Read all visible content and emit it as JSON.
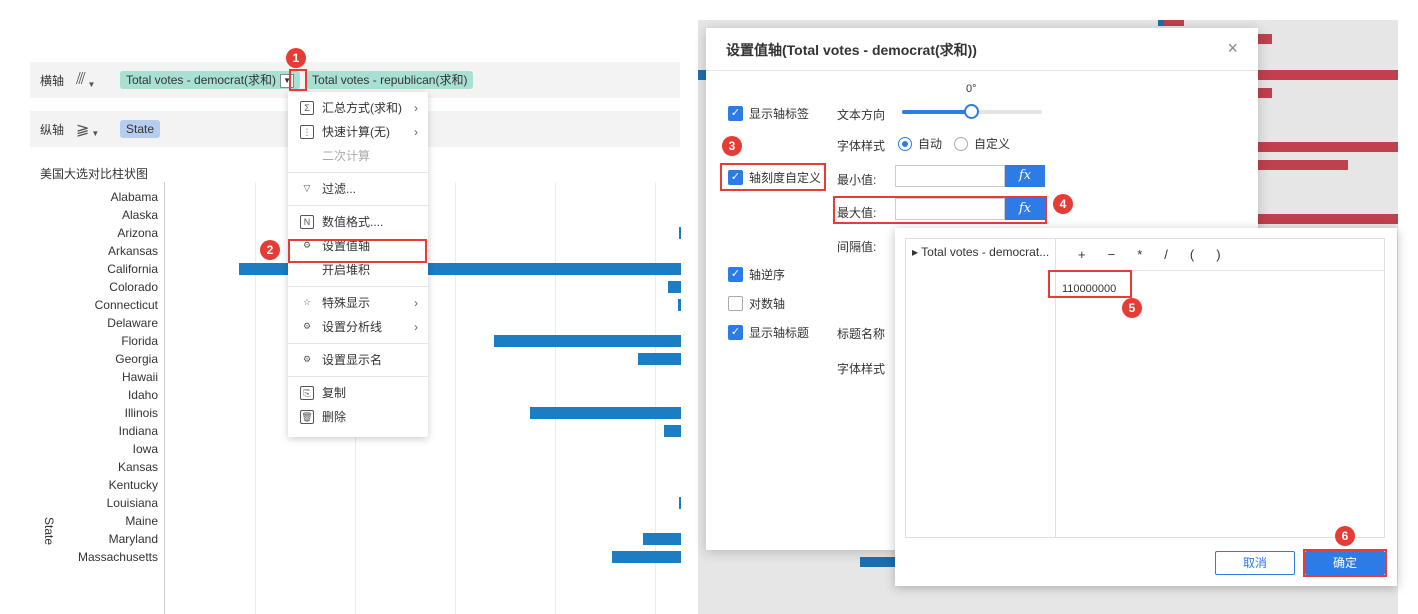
{
  "shelves": {
    "horizontal_label": "横轴",
    "vertical_label": "纵轴",
    "horizontal_pills": [
      "Total votes - democrat(求和)",
      "Total votes - republican(求和)"
    ],
    "vertical_pills": [
      "State"
    ]
  },
  "chart": {
    "title": "美国大选对比柱状图",
    "axis_title": "State",
    "states": [
      "Alabama",
      "Alaska",
      "Arizona",
      "Arkansas",
      "California",
      "Colorado",
      "Connecticut",
      "Delaware",
      "Florida",
      "Georgia",
      "Hawaii",
      "Idaho",
      "Illinois",
      "Indiana",
      "Iowa",
      "Kansas",
      "Kentucky",
      "Louisiana",
      "Maine",
      "Maryland",
      "Massachusetts"
    ]
  },
  "chart_data": {
    "type": "bar",
    "categories": [
      "Alabama",
      "Alaska",
      "Arizona",
      "Arkansas",
      "California",
      "Colorado",
      "Connecticut",
      "Delaware",
      "Florida",
      "Georgia",
      "Hawaii",
      "Idaho",
      "Illinois",
      "Indiana",
      "Iowa",
      "Kansas",
      "Kentucky",
      "Louisiana",
      "Maine",
      "Maryland",
      "Massachusetts"
    ],
    "values": [
      0,
      0,
      2,
      0,
      442,
      13,
      3,
      0,
      187,
      43,
      0,
      0,
      151,
      17,
      0,
      0,
      0,
      2,
      0,
      38,
      69
    ],
    "axis_max": 442
  },
  "menu": {
    "items": [
      {
        "label": "汇总方式(求和)",
        "icon": "sigma-icon",
        "glyph": "Σ",
        "arrow": true,
        "disabled": false
      },
      {
        "label": "快速计算(无)",
        "icon": "quick-calc-icon",
        "glyph": "⋮",
        "arrow": true,
        "disabled": false
      },
      {
        "label": "二次计算",
        "icon": "",
        "glyph": "",
        "arrow": false,
        "disabled": true
      },
      {
        "label": "过滤...",
        "icon": "filter-icon",
        "glyph": "▽",
        "arrow": false,
        "disabled": false
      },
      {
        "label": "数值格式....",
        "icon": "number-format-icon",
        "glyph": "N",
        "arrow": false,
        "disabled": false
      },
      {
        "label": "设置值轴",
        "icon": "gear-icon",
        "glyph": "⚙",
        "arrow": false,
        "disabled": false
      },
      {
        "label": "开启堆积",
        "icon": "",
        "glyph": "",
        "arrow": false,
        "disabled": false
      },
      {
        "label": "特殊显示",
        "icon": "star-icon",
        "glyph": "☆",
        "arrow": true,
        "disabled": false
      },
      {
        "label": "设置分析线",
        "icon": "gear-icon",
        "glyph": "⚙",
        "arrow": true,
        "disabled": false
      },
      {
        "label": "设置显示名",
        "icon": "gear-icon",
        "glyph": "⚙",
        "arrow": false,
        "disabled": false
      },
      {
        "label": "复制",
        "icon": "copy-icon",
        "glyph": "⎘",
        "arrow": false,
        "disabled": false
      },
      {
        "label": "删除",
        "icon": "trash-icon",
        "glyph": "🗑",
        "arrow": false,
        "disabled": false
      }
    ]
  },
  "markers": [
    "1",
    "2",
    "3",
    "4",
    "5",
    "6"
  ],
  "dialog": {
    "title": "设置值轴(Total votes - democrat(求和))",
    "close": "×",
    "show_axis_label": "显示轴标签",
    "axis_custom": "轴刻度自定义",
    "reverse_axis": "轴逆序",
    "log_axis": "对数轴",
    "show_axis_title": "显示轴标题",
    "text_direction": "文本方向",
    "slider_value": "0°",
    "font_style": "字体样式",
    "auto": "自动",
    "custom": "自定义",
    "min_value": "最小值:",
    "max_value": "最大值:",
    "interval": "间隔值:",
    "title_name": "标题名称",
    "font_style2": "字体样式",
    "fx": "fx"
  },
  "formula": {
    "field": "Total votes - democrat...",
    "ops": [
      "+",
      "−",
      "*",
      "/",
      "(",
      ")"
    ],
    "expression": "110000000",
    "cancel": "取消",
    "ok": "确定"
  },
  "colors": {
    "accent": "#2d7be5",
    "bar": "#1c7dc2",
    "marker": "#e63c35",
    "pill_green": "#a8e0d4",
    "pill_blue": "#b7cdef"
  }
}
